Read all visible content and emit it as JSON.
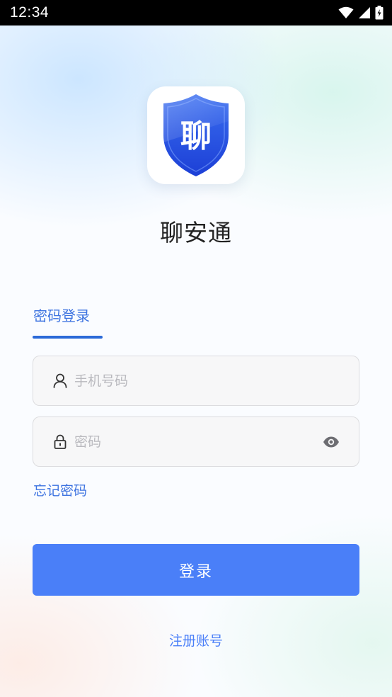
{
  "status_bar": {
    "time": "12:34",
    "icons": [
      "wifi-icon",
      "signal-icon",
      "battery-icon"
    ]
  },
  "app": {
    "logo_char": "聊",
    "name": "聊安通"
  },
  "login_tab": {
    "label": "密码登录"
  },
  "phone_field": {
    "placeholder": "手机号码",
    "value": "",
    "icon": "user-icon"
  },
  "password_field": {
    "placeholder": "密码",
    "value": "",
    "icon": "lock-icon",
    "toggle_icon": "eye-icon"
  },
  "forgot_password": "忘记密码",
  "login_button": "登录",
  "register_link": "注册账号",
  "colors": {
    "primary": "#4a7ff8",
    "link": "#3d73e0",
    "tab_underline": "#2b6ad8",
    "shield_top": "#3a6ef0",
    "shield_bottom": "#1c3fd6"
  }
}
